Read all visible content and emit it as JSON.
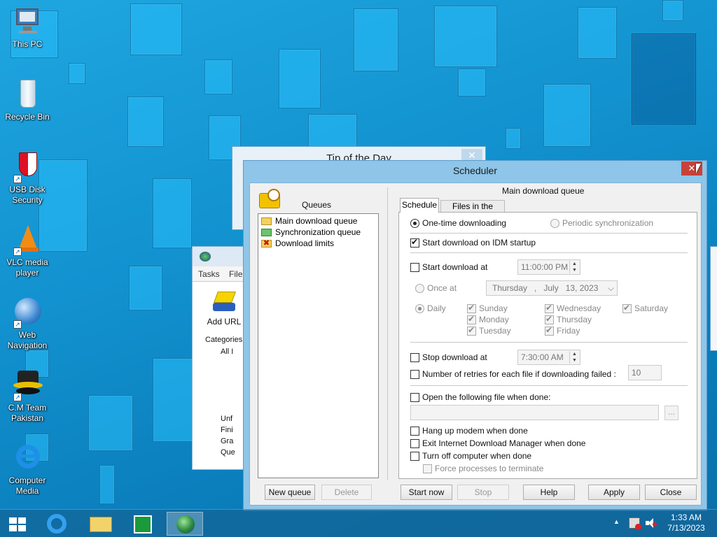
{
  "desktop": {
    "icons": [
      {
        "label": "This PC",
        "icon": "computer-icon"
      },
      {
        "label": "Recycle Bin",
        "icon": "recycle-bin-icon"
      },
      {
        "label": "USB Disk Security",
        "icon": "shield-icon"
      },
      {
        "label": "VLC media player",
        "icon": "vlc-cone-icon"
      },
      {
        "label": "Web Navigation",
        "icon": "globe-icon"
      },
      {
        "label": "C.M Team Pakistan",
        "icon": "cm-hat-icon"
      },
      {
        "label": "Computer Media",
        "icon": "internet-explorer-icon"
      }
    ]
  },
  "tip_window": {
    "title": "Tip of the Day",
    "close": "✕"
  },
  "idm_window": {
    "menu_tasks": "Tasks",
    "menu_file": "File",
    "add_url": "Add URL",
    "categories": "Categories",
    "tree_items": [
      "All I",
      "Unf",
      "Fini",
      "Gra",
      "Que"
    ]
  },
  "scheduler": {
    "title": "Scheduler",
    "close": "✕",
    "queues_label": "Queues",
    "queues": [
      "Main download queue",
      "Synchronization queue",
      "Download limits"
    ],
    "new_queue": "New queue",
    "delete": "Delete",
    "current_queue": "Main download queue",
    "tabs": [
      "Schedule",
      "Files in the queue"
    ],
    "one_time": "One-time downloading",
    "periodic": "Periodic synchronization",
    "start_on_startup": "Start download on IDM startup",
    "start_at": "Start download at",
    "start_time": "11:00:00 PM",
    "once_at": "Once at",
    "date": {
      "day": "Thursday",
      "sep": ",",
      "month": "July",
      "rest": "13, 2023"
    },
    "daily": "Daily",
    "days": [
      "Sunday",
      "Monday",
      "Tuesday",
      "Wednesday",
      "Thursday",
      "Friday",
      "Saturday"
    ],
    "stop_at": "Stop download at",
    "stop_time": "7:30:00 AM",
    "retries_label": "Number of retries for each file if downloading failed :",
    "retries_value": "10",
    "open_file": "Open the following file when done:",
    "browse": "...",
    "hang_up": "Hang up modem when done",
    "exit_idm": "Exit Internet Download Manager when done",
    "turn_off": "Turn off computer when done",
    "force": "Force processes to terminate",
    "buttons": {
      "start_now": "Start now",
      "stop": "Stop",
      "help": "Help",
      "apply": "Apply",
      "close": "Close"
    }
  },
  "taskbar": {
    "time": "1:33 AM",
    "date": "7/13/2023",
    "tray_arrow": "▲"
  }
}
